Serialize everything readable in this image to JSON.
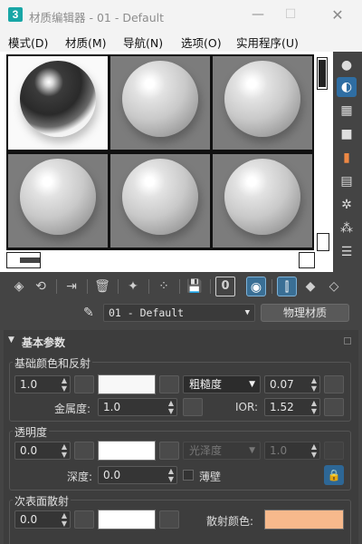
{
  "window": {
    "title": "材质编辑器 - 01 - Default",
    "icon_letter": "3"
  },
  "menu": [
    "模式(D)",
    "材质(M)",
    "导航(N)",
    "选项(O)",
    "实用程序(U)"
  ],
  "material": {
    "name": "01 - Default",
    "type": "物理材质"
  },
  "toolbar": {
    "id_channel": "0"
  },
  "rollout": {
    "title": "基本参数"
  },
  "base": {
    "group_label": "基础颜色和反射",
    "weight": "1.0",
    "base_color": "#f8f8f8",
    "roughness_mode": "粗糙度",
    "roughness": "0.07",
    "metalness_label": "金属度:",
    "metalness": "1.0",
    "ior_label": "IOR:",
    "ior": "1.52"
  },
  "transparency": {
    "group_label": "透明度",
    "weight": "0.0",
    "color": "#ffffff",
    "glossiness_mode": "光泽度",
    "glossiness": "1.0",
    "depth_label": "深度:",
    "depth": "0.0",
    "thin_walled_label": "薄壁"
  },
  "sss": {
    "group_label": "次表面散射",
    "weight": "0.0",
    "color": "#ffffff",
    "scatter_label": "散射颜色:",
    "scatter_color": "#f7b98c"
  },
  "colors": {
    "accent": "#2f6ea3",
    "panel": "#3d3d3d"
  }
}
